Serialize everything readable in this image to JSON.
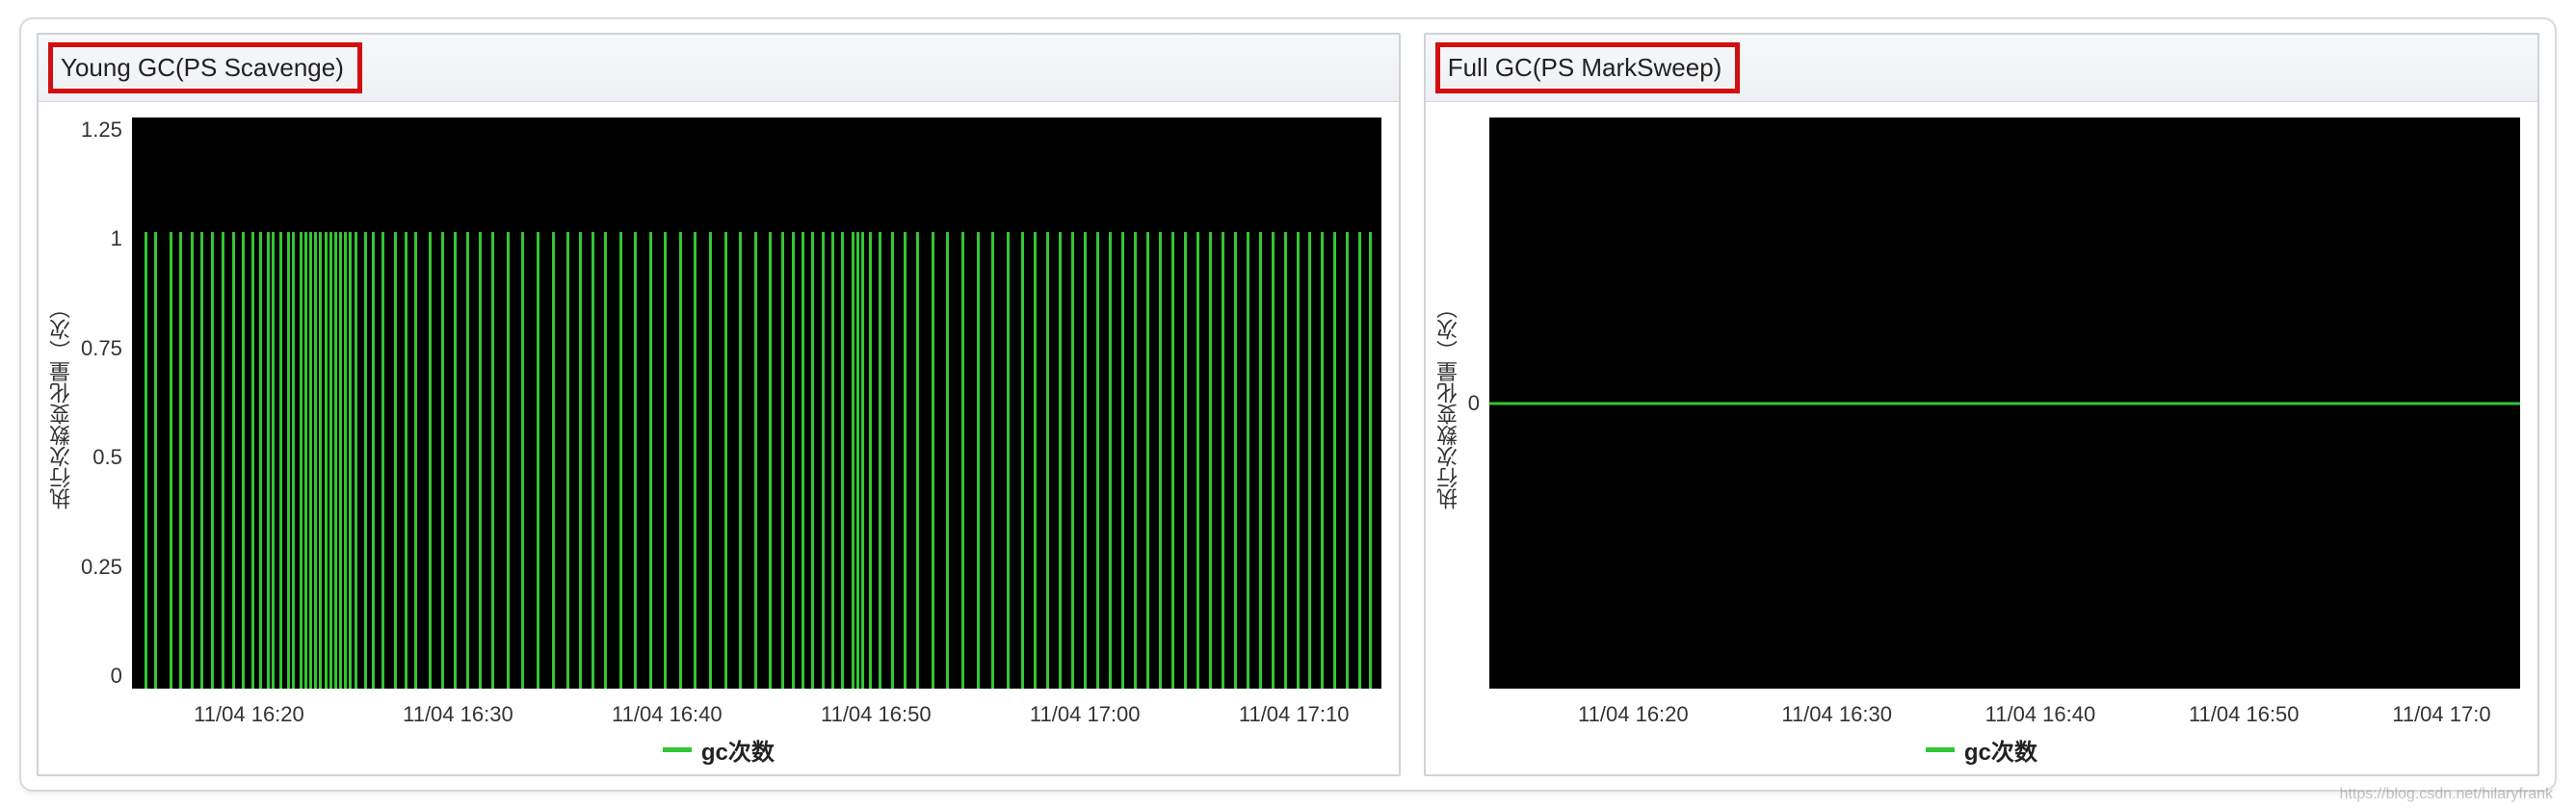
{
  "legend_label": "gc次数",
  "y_axis_label": "执行次数变化量（次）",
  "watermark": "https://blog.csdn.net/hilaryfrank",
  "chart_data": [
    {
      "type": "bar",
      "title": "Young GC(PS Scavenge)",
      "ylabel": "执行次数变化量（次）",
      "xlabel": "",
      "ylim": [
        0,
        1.25
      ],
      "y_ticks": [
        "1.25",
        "1",
        "0.75",
        "0.5",
        "0.25",
        "0"
      ],
      "x_ticks": [
        "11/04 16:20",
        "11/04 16:30",
        "11/04 16:40",
        "11/04 16:50",
        "11/04 17:00",
        "11/04 17:10"
      ],
      "series": [
        {
          "name": "gc次数",
          "note": "Many dense bars across the time range; each bar is either 0 or 1. Positions are fractional 0..1 across x-axis.",
          "bars_at_value_1_x_positions": [
            0.01,
            0.018,
            0.03,
            0.038,
            0.047,
            0.055,
            0.063,
            0.072,
            0.08,
            0.088,
            0.096,
            0.102,
            0.108,
            0.112,
            0.118,
            0.124,
            0.128,
            0.134,
            0.138,
            0.142,
            0.146,
            0.15,
            0.154,
            0.158,
            0.162,
            0.166,
            0.17,
            0.174,
            0.178,
            0.186,
            0.192,
            0.2,
            0.21,
            0.218,
            0.226,
            0.238,
            0.248,
            0.258,
            0.268,
            0.278,
            0.288,
            0.3,
            0.312,
            0.324,
            0.336,
            0.348,
            0.358,
            0.368,
            0.378,
            0.39,
            0.402,
            0.414,
            0.426,
            0.438,
            0.45,
            0.462,
            0.474,
            0.486,
            0.498,
            0.51,
            0.52,
            0.528,
            0.536,
            0.544,
            0.552,
            0.56,
            0.568,
            0.576,
            0.58,
            0.584,
            0.59,
            0.598,
            0.608,
            0.618,
            0.628,
            0.64,
            0.652,
            0.664,
            0.676,
            0.688,
            0.7,
            0.712,
            0.722,
            0.732,
            0.742,
            0.752,
            0.762,
            0.772,
            0.782,
            0.792,
            0.802,
            0.812,
            0.822,
            0.832,
            0.842,
            0.852,
            0.862,
            0.872,
            0.882,
            0.892,
            0.902,
            0.912,
            0.922,
            0.932,
            0.942,
            0.952,
            0.962,
            0.972,
            0.982,
            0.99
          ]
        }
      ]
    },
    {
      "type": "line",
      "title": "Full GC(PS MarkSweep)",
      "ylabel": "执行次数变化量（次）",
      "xlabel": "",
      "y_ticks": [
        "0"
      ],
      "x_ticks": [
        "11/04 16:20",
        "11/04 16:30",
        "11/04 16:40",
        "11/04 16:50",
        "11/04 17:0"
      ],
      "series": [
        {
          "name": "gc次数",
          "constant_value": 0
        }
      ]
    }
  ]
}
